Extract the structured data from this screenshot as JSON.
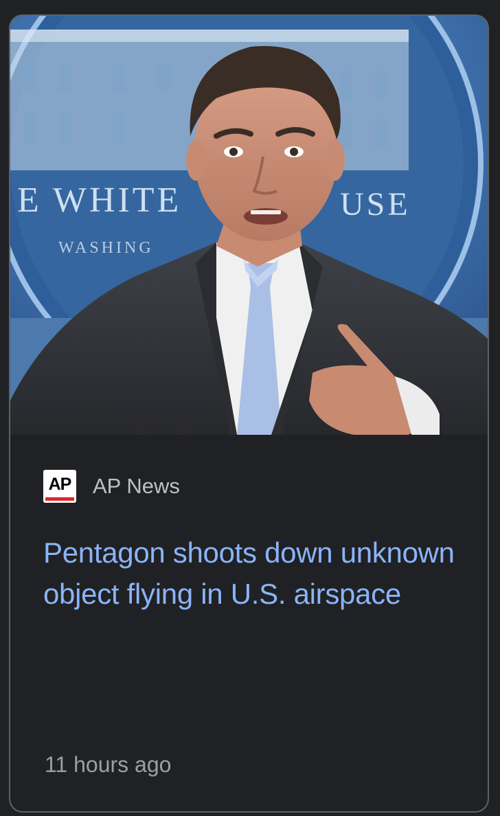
{
  "card": {
    "hero_image_alt": "Man in a suit gesturing at a podium in front of a blue seal",
    "source": {
      "logo_text": "AP",
      "name": "AP News"
    },
    "headline": "Pentagon shoots down unknown object flying in U.S. airspace",
    "timestamp": "11 hours ago"
  },
  "colors": {
    "background": "#202124",
    "card_border": "#5f6368",
    "headline": "#8ab4f8",
    "source_name": "#bdc1c6",
    "timestamp": "#9aa0a6",
    "ap_red": "#e0262b"
  },
  "seal_text": {
    "line1": "E WHITE",
    "line1b": "USE",
    "line2": "WASHING"
  }
}
